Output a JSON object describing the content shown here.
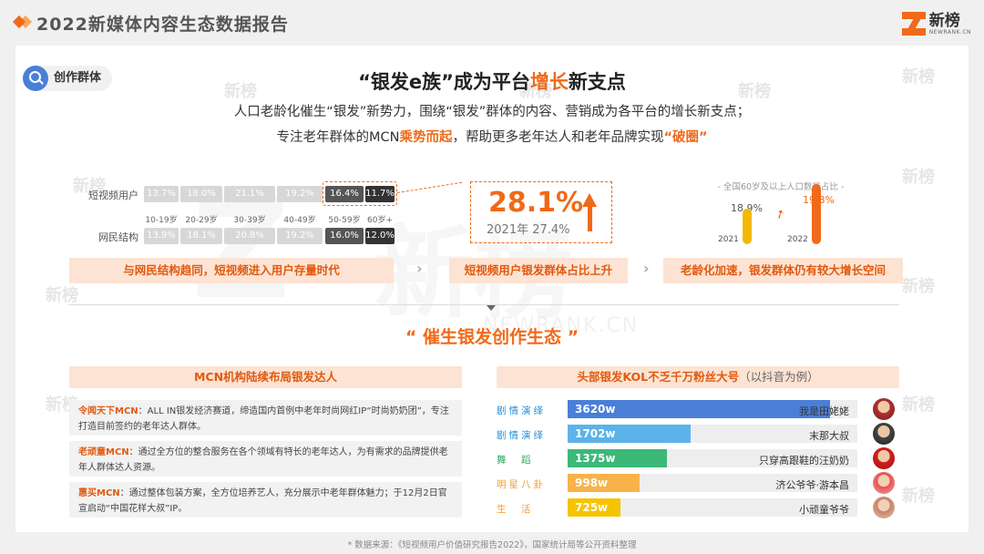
{
  "header": {
    "report_title": "2022新媒体内容生态数据报告"
  },
  "logo": {
    "name": "新榜",
    "sub": "NEWRANK.CN"
  },
  "watermark": {
    "text": "新榜",
    "url": "NEWRANK.CN"
  },
  "tag": {
    "label": "创作群体"
  },
  "headline": {
    "part1": "“银发e族”成为平台",
    "highlight": "增长",
    "part2": "新支点"
  },
  "subtitle": {
    "line1": "人口老龄化催生“银发”新势力，围绕“银发”群体的内容、营销成为各平台的增长新支点；",
    "line2_a": "专注老年群体的MCN",
    "line2_hl1": "乘势而起",
    "line2_b": "，帮助更多老年达人和老年品牌实现",
    "line2_hl2": "“破圈”"
  },
  "age_structure": {
    "rows": [
      {
        "label": "短视频用户",
        "values": [
          "13.7%",
          "18.0%",
          "21.1%",
          "19.2%",
          "16.4%",
          "11.7%"
        ]
      },
      {
        "label": "网民结构",
        "values": [
          "13.9%",
          "18.1%",
          "20.8%",
          "19.2%",
          "16.0%",
          "12.0%"
        ]
      }
    ],
    "age_groups": [
      "10-19岁",
      "20-29岁",
      "30-39岁",
      "40-49岁",
      "50-59岁",
      "60岁+"
    ]
  },
  "highlight_stat": {
    "value": "28.1%",
    "compare": "2021年 27.4%"
  },
  "population": {
    "title": "- 全国60岁及以上人口数量占比 -",
    "values": [
      "18.9%",
      "19.8%"
    ],
    "years": [
      "2021",
      "2022"
    ],
    "colors": [
      "#f5b800",
      "#f06a1a"
    ]
  },
  "pills": [
    "与网民结构趋同，短视频进入用户存量时代",
    "短视频用户银发群体占比上升",
    "老龄化加速，银发群体仍有较大增长空间"
  ],
  "section": {
    "title": "“  催生银发创作生态  ”"
  },
  "mcn": {
    "title": "MCN机构陆续布局银发达人",
    "items": [
      {
        "name": "令闻天下MCN",
        "text": "：ALL IN银发经济赛道，缔造国内首例中老年时尚网红IP“时尚奶奶团”，专注打造目前签约的老年达人群体。"
      },
      {
        "name": "老顽童MCN",
        "text": "：通过全方位的整合服务在各个领域有特长的老年达人，为有需求的品牌提供老年人群体达人资源。"
      },
      {
        "name": "惠买MCN",
        "text": "：通过整体包装方案，全方位培养艺人，充分展示中老年群体魅力；于12月2日官宣启动“中国花样大叔”IP。"
      }
    ]
  },
  "kol": {
    "title": "头部银发KOL不乏千万粉丝大号",
    "title_note": "（以抖音为例）",
    "items": [
      {
        "category": "剧情演绎",
        "fans": "3620w",
        "value": 3620,
        "name": "我是田姥姥",
        "color": "#4a7fd8"
      },
      {
        "category": "剧情演绎",
        "fans": "1702w",
        "value": 1702,
        "name": "末那大叔",
        "color": "#5bb3ea"
      },
      {
        "category": "舞　蹈",
        "fans": "1375w",
        "value": 1375,
        "name": "只穿高跟鞋的汪奶奶",
        "color": "#3cb878"
      },
      {
        "category": "明星八卦",
        "fans": "998w",
        "value": 998,
        "name": "济公爷爷·游本昌",
        "color": "#f7b24a"
      },
      {
        "category": "生　活",
        "fans": "725w",
        "value": 725,
        "name": "小顽童爷爷",
        "color": "#f5c400"
      }
    ]
  },
  "footnote": "* 数据来源：《短视频用户价值研究报告2022》，国家统计局等公开资料整理"
}
